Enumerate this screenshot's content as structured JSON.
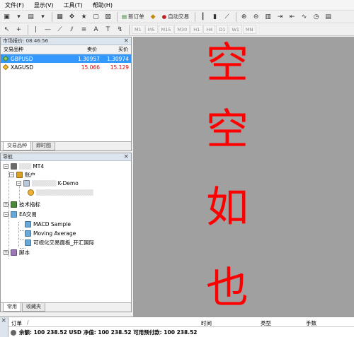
{
  "menu": [
    "文件(F)",
    "显示(V)",
    "工具(T)",
    "帮助(H)"
  ],
  "toolbar": {
    "new_order": "新订单",
    "auto_trading": "自动交易",
    "timeframes": [
      "M1",
      "M5",
      "M15",
      "M30",
      "H1",
      "H4",
      "D1",
      "W1",
      "MN"
    ]
  },
  "market_watch": {
    "title": "市场报价: 08:46:56",
    "headers": {
      "symbol": "交易品种",
      "bid": "卖价",
      "ask": "买价"
    },
    "rows": [
      {
        "symbol": "GBPUSD",
        "bid": "1.30957",
        "ask": "1.30974"
      },
      {
        "symbol": "XAGUSD",
        "bid": "15.066",
        "ask": "15.129"
      }
    ],
    "tabs": [
      "交易品种",
      "即时图"
    ]
  },
  "navigator": {
    "title": "导航",
    "root": "MT4",
    "accounts": "账户",
    "account_server": "K-Demo",
    "indicators": "技术指标",
    "experts": "EA交易",
    "expert_items": [
      "MACD Sample",
      "Moving Average",
      "可视化交易面板_开汇国际"
    ],
    "scripts": "脚本",
    "tabs": [
      "常用",
      "收藏夹"
    ]
  },
  "chart": {
    "overlay_chars": [
      "空",
      "空",
      "如",
      "也"
    ],
    "background": "#a0a0a0",
    "text_color": "#ff0000"
  },
  "terminal": {
    "headers": {
      "order": "订单",
      "time": "时间",
      "type": "类型",
      "lots": "手数"
    },
    "order_sort": "/",
    "balance_line": "余额: 100 238.52 USD  净值: 100 238.52  可用预付款: 100 238.52"
  }
}
